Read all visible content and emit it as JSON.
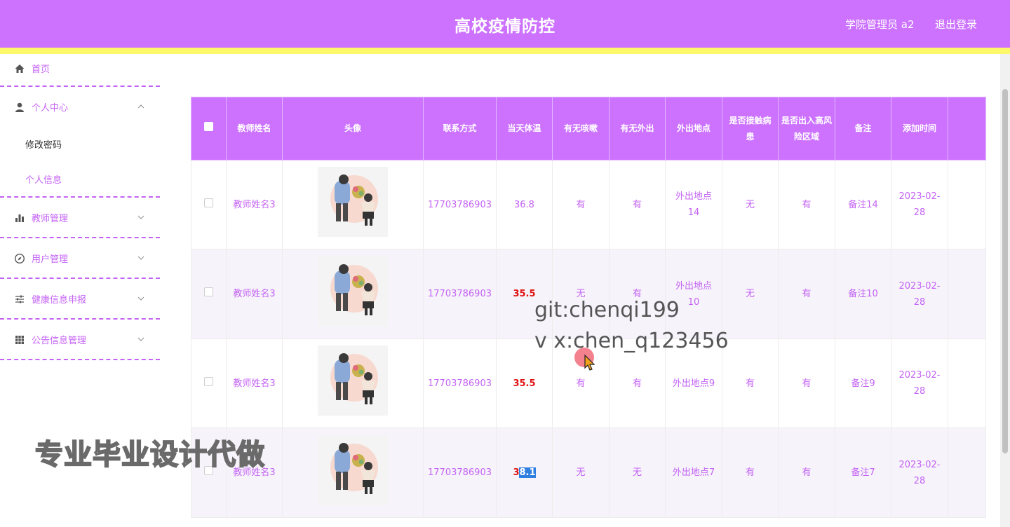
{
  "header": {
    "title": "高校疫情防控",
    "user": "学院管理员 a2",
    "logout": "退出登录"
  },
  "sidebar": {
    "home": {
      "label": "首页",
      "icon": "home-icon"
    },
    "personal": {
      "label": "个人中心",
      "icon": "user-icon",
      "children": [
        {
          "label": "修改密码"
        },
        {
          "label": "个人信息"
        }
      ]
    },
    "teacher": {
      "label": "教师管理",
      "icon": "bar-chart-icon"
    },
    "users": {
      "label": "用户管理",
      "icon": "compass-icon"
    },
    "health": {
      "label": "健康信息申报",
      "icon": "sliders-icon"
    },
    "notice": {
      "label": "公告信息管理",
      "icon": "grid-icon"
    }
  },
  "table": {
    "headers": [
      "教师姓名",
      "头像",
      "联系方式",
      "当天体温",
      "有无咳嗽",
      "有无外出",
      "外出地点",
      "是否接触病患",
      "是否出入高风险区域",
      "备注",
      "添加时间"
    ],
    "rows": [
      {
        "name": "教师姓名3",
        "phone": "17703786903",
        "temp": "36.8",
        "cough": "有",
        "out": "有",
        "place": "外出地点14",
        "contact": "无",
        "risk": "有",
        "note": "备注14",
        "time": "2023-02-28"
      },
      {
        "name": "教师姓名3",
        "phone": "17703786903",
        "temp": "35.5",
        "cough": "无",
        "out": "有",
        "place": "外出地点10",
        "contact": "无",
        "risk": "有",
        "note": "备注10",
        "time": "2023-02-28"
      },
      {
        "name": "教师姓名3",
        "phone": "17703786903",
        "temp": "35.5",
        "cough": "有",
        "out": "有",
        "place": "外出地点9",
        "contact": "有",
        "risk": "有",
        "note": "备注9",
        "time": "2023-02-28"
      },
      {
        "name": "教师姓名3",
        "phone": "17703786903",
        "temp_prefix": "3",
        "temp_selected": "8.1",
        "cough": "无",
        "out": "无",
        "place": "外出地点7",
        "contact": "有",
        "risk": "有",
        "note": "备注7",
        "time": "2023-02-28"
      }
    ]
  },
  "watermarks": {
    "git": "git:chenqi199",
    "vx": "v x:chen_q123456",
    "banner": "专业毕业设计代做"
  },
  "colors": {
    "primary": "#cc72ff",
    "text": "#c463f5",
    "stripe": "#fdf86a",
    "alert": "#e01313"
  }
}
